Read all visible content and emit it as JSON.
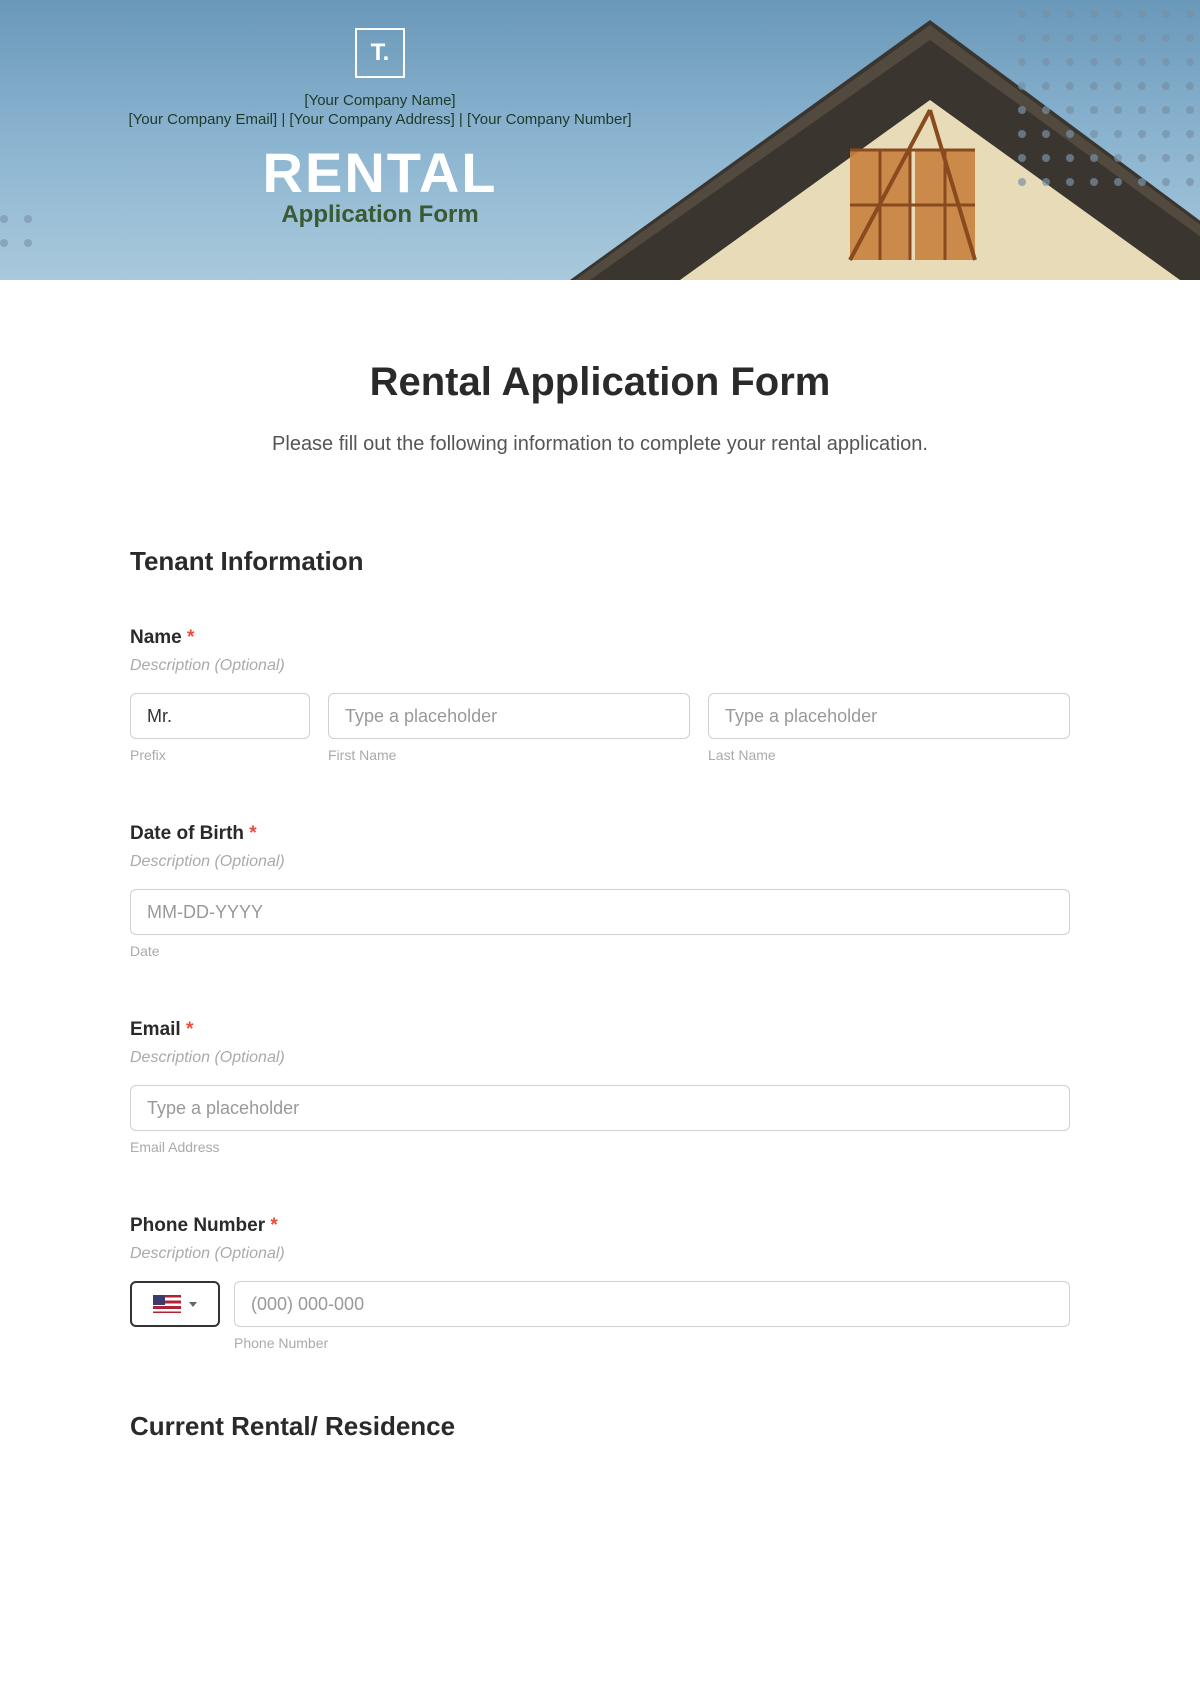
{
  "banner": {
    "logo_text": "T.",
    "company_line1": "[Your Company Name]",
    "company_line2": "[Your Company Email]  |  [Your Company Address]  |  [Your Company Number]",
    "title": "RENTAL",
    "subtitle": "Application Form"
  },
  "page": {
    "title": "Rental Application Form",
    "subtitle": "Please fill out the following information to complete your rental application."
  },
  "sections": {
    "tenant": {
      "heading": "Tenant Information",
      "name": {
        "label": "Name",
        "desc": "Description (Optional)",
        "prefix_value": "Mr.",
        "prefix_sub": "Prefix",
        "first_placeholder": "Type a placeholder",
        "first_sub": "First Name",
        "last_placeholder": "Type a placeholder",
        "last_sub": "Last Name"
      },
      "dob": {
        "label": "Date of Birth",
        "desc": "Description (Optional)",
        "placeholder": "MM-DD-YYYY",
        "sub": "Date"
      },
      "email": {
        "label": "Email",
        "desc": "Description (Optional)",
        "placeholder": "Type a placeholder",
        "sub": "Email Address"
      },
      "phone": {
        "label": "Phone Number",
        "desc": "Description (Optional)",
        "placeholder": "(000) 000-000",
        "sub": "Phone Number"
      }
    },
    "current": {
      "heading": "Current Rental/ Residence"
    }
  },
  "required_marker": "*"
}
